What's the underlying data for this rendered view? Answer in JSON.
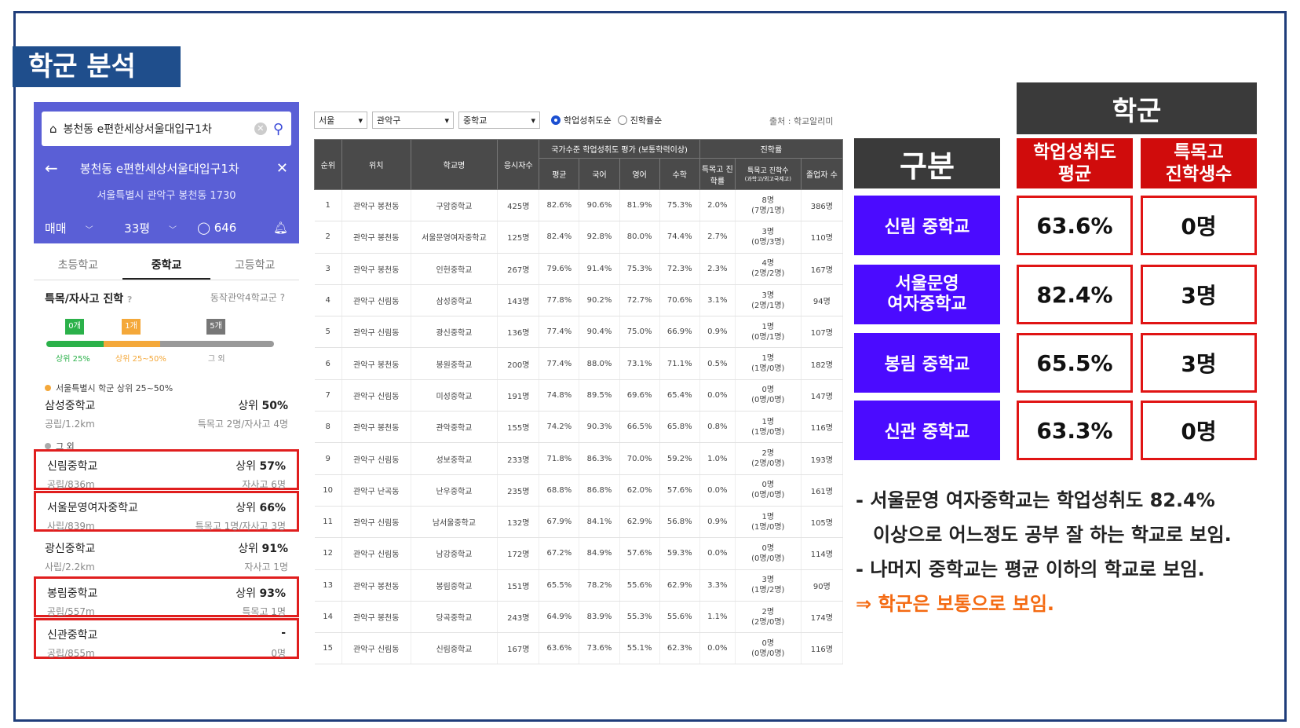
{
  "title": "학군 분석",
  "app": {
    "search_text": "봉천동 e편한세상서울대입구1차",
    "complex_name": "봉천동 e편한세상서울대입구1차",
    "address": "서울특별시 관악구 봉천동 1730",
    "trade_type": "매매",
    "size": "33평",
    "talk_count": "646",
    "tabs": [
      "초등학교",
      "중학교",
      "고등학교"
    ],
    "active_tab": "중학교",
    "advance_title": "특목/자사고 진학",
    "region_label": "동작관악4학교군",
    "flags": [
      "0개",
      "1개",
      "5개"
    ],
    "progress": {
      "top25": 0.25,
      "mid": 0.25,
      "rest": 0.5
    },
    "progress_labels": [
      "상위 25%",
      "상위 25~50%",
      "그 외"
    ],
    "group1_note": "서울특별시 학군 상위 25~50%",
    "group2_note": "그 외",
    "schools": [
      {
        "name": "삼성중학교",
        "rank_prefix": "상위",
        "rank_value": "50%",
        "sub": "공립/1.2km",
        "advance": "특목고 2명/자사고 4명"
      },
      {
        "name": "신림중학교",
        "rank_prefix": "상위",
        "rank_value": "57%",
        "sub": "공립/836m",
        "advance": "자사고 6명"
      },
      {
        "name": "서울문영여자중학교",
        "rank_prefix": "상위",
        "rank_value": "66%",
        "sub": "사립/839m",
        "advance": "특목고 1명/자사고 3명"
      },
      {
        "name": "광신중학교",
        "rank_prefix": "상위",
        "rank_value": "91%",
        "sub": "사립/2.2km",
        "advance": "자사고 1명"
      },
      {
        "name": "봉림중학교",
        "rank_prefix": "상위",
        "rank_value": "93%",
        "sub": "공립/557m",
        "advance": "특목고 1명"
      },
      {
        "name": "신관중학교",
        "rank_prefix": "",
        "rank_value": "-",
        "sub": "공립/855m",
        "advance": "0명"
      }
    ]
  },
  "filters": {
    "city": "서울",
    "district": "관악구",
    "level": "중학교",
    "radio1": "학업성취도순",
    "radio2": "진학률순",
    "source": "출처 : 학교알리미"
  },
  "table": {
    "headers": {
      "rank": "순위",
      "location": "위치",
      "school": "학교명",
      "examinees": "응시자수",
      "group1": "국가수준 학업성취도 평가 (보통학력이상)",
      "avg": "평균",
      "kor": "국어",
      "eng": "영어",
      "math": "수학",
      "group2": "진학률",
      "special_rate": "특목고 진학률",
      "special_count": "특목고 진학수",
      "special_count_sub": "(과학고/외고국제고)",
      "grads": "졸업자 수"
    },
    "rows": [
      [
        "1",
        "관악구 봉천동",
        "구암중학교",
        "425명",
        "82.6%",
        "90.6%",
        "81.9%",
        "75.3%",
        "2.0%",
        "8명",
        "(7명/1명)",
        "386명"
      ],
      [
        "2",
        "관악구 봉천동",
        "서울문영여자중학교",
        "125명",
        "82.4%",
        "92.8%",
        "80.0%",
        "74.4%",
        "2.7%",
        "3명",
        "(0명/3명)",
        "110명"
      ],
      [
        "3",
        "관악구 봉천동",
        "인헌중학교",
        "267명",
        "79.6%",
        "91.4%",
        "75.3%",
        "72.3%",
        "2.3%",
        "4명",
        "(2명/2명)",
        "167명"
      ],
      [
        "4",
        "관악구 신림동",
        "삼성중학교",
        "143명",
        "77.8%",
        "90.2%",
        "72.7%",
        "70.6%",
        "3.1%",
        "3명",
        "(2명/1명)",
        "94명"
      ],
      [
        "5",
        "관악구 신림동",
        "광신중학교",
        "136명",
        "77.4%",
        "90.4%",
        "75.0%",
        "66.9%",
        "0.9%",
        "1명",
        "(0명/1명)",
        "107명"
      ],
      [
        "6",
        "관악구 봉천동",
        "봉원중학교",
        "200명",
        "77.4%",
        "88.0%",
        "73.1%",
        "71.1%",
        "0.5%",
        "1명",
        "(1명/0명)",
        "182명"
      ],
      [
        "7",
        "관악구 신림동",
        "미성중학교",
        "191명",
        "74.8%",
        "89.5%",
        "69.6%",
        "65.4%",
        "0.0%",
        "0명",
        "(0명/0명)",
        "147명"
      ],
      [
        "8",
        "관악구 봉천동",
        "관악중학교",
        "155명",
        "74.2%",
        "90.3%",
        "66.5%",
        "65.8%",
        "0.8%",
        "1명",
        "(1명/0명)",
        "116명"
      ],
      [
        "9",
        "관악구 신림동",
        "성보중학교",
        "233명",
        "71.8%",
        "86.3%",
        "70.0%",
        "59.2%",
        "1.0%",
        "2명",
        "(2명/0명)",
        "193명"
      ],
      [
        "10",
        "관악구 난곡동",
        "난우중학교",
        "235명",
        "68.8%",
        "86.8%",
        "62.0%",
        "57.6%",
        "0.0%",
        "0명",
        "(0명/0명)",
        "161명"
      ],
      [
        "11",
        "관악구 신림동",
        "남서울중학교",
        "132명",
        "67.9%",
        "84.1%",
        "62.9%",
        "56.8%",
        "0.9%",
        "1명",
        "(1명/0명)",
        "105명"
      ],
      [
        "12",
        "관악구 신림동",
        "남강중학교",
        "172명",
        "67.2%",
        "84.9%",
        "57.6%",
        "59.3%",
        "0.0%",
        "0명",
        "(0명/0명)",
        "114명"
      ],
      [
        "13",
        "관악구 봉천동",
        "봉림중학교",
        "151명",
        "65.5%",
        "78.2%",
        "55.6%",
        "62.9%",
        "3.3%",
        "3명",
        "(1명/2명)",
        "90명"
      ],
      [
        "14",
        "관악구 봉천동",
        "당곡중학교",
        "243명",
        "64.9%",
        "83.9%",
        "55.3%",
        "55.6%",
        "1.1%",
        "2명",
        "(2명/0명)",
        "174명"
      ],
      [
        "15",
        "관악구 신림동",
        "신림중학교",
        "167명",
        "63.6%",
        "73.6%",
        "55.1%",
        "62.3%",
        "0.0%",
        "0명",
        "(0명/0명)",
        "116명"
      ]
    ]
  },
  "summary": {
    "header": "학군",
    "col_label": "구분",
    "col1": [
      "학업성취도",
      "평균"
    ],
    "col2": [
      "특목고",
      "진학생수"
    ],
    "rows": [
      {
        "label": [
          "신림 중학교"
        ],
        "avg": "63.6%",
        "count": "0명"
      },
      {
        "label": [
          "서울문영",
          "여자중학교"
        ],
        "avg": "82.4%",
        "count": "3명"
      },
      {
        "label": [
          "봉림 중학교"
        ],
        "avg": "65.5%",
        "count": "3명"
      },
      {
        "label": [
          "신관 중학교"
        ],
        "avg": "63.3%",
        "count": "0명"
      }
    ],
    "notes": [
      "- 서울문영 여자중학교는 학업성취도 82.4%",
      "  이상으로 어느정도 공부 잘 하는 학교로 보임.",
      "- 나머지 중학교는 평균 이하의 학교로 보임."
    ],
    "conclusion": "⇒ 학군은 보통으로 보임."
  },
  "colors": {
    "title_bg": "#1f4e8c",
    "app_header": "#5a5fd6",
    "highlight": "#e01e1e",
    "label_blue": "#4b0bff",
    "header_red": "#d00c0c",
    "conclusion": "#f46a12"
  }
}
